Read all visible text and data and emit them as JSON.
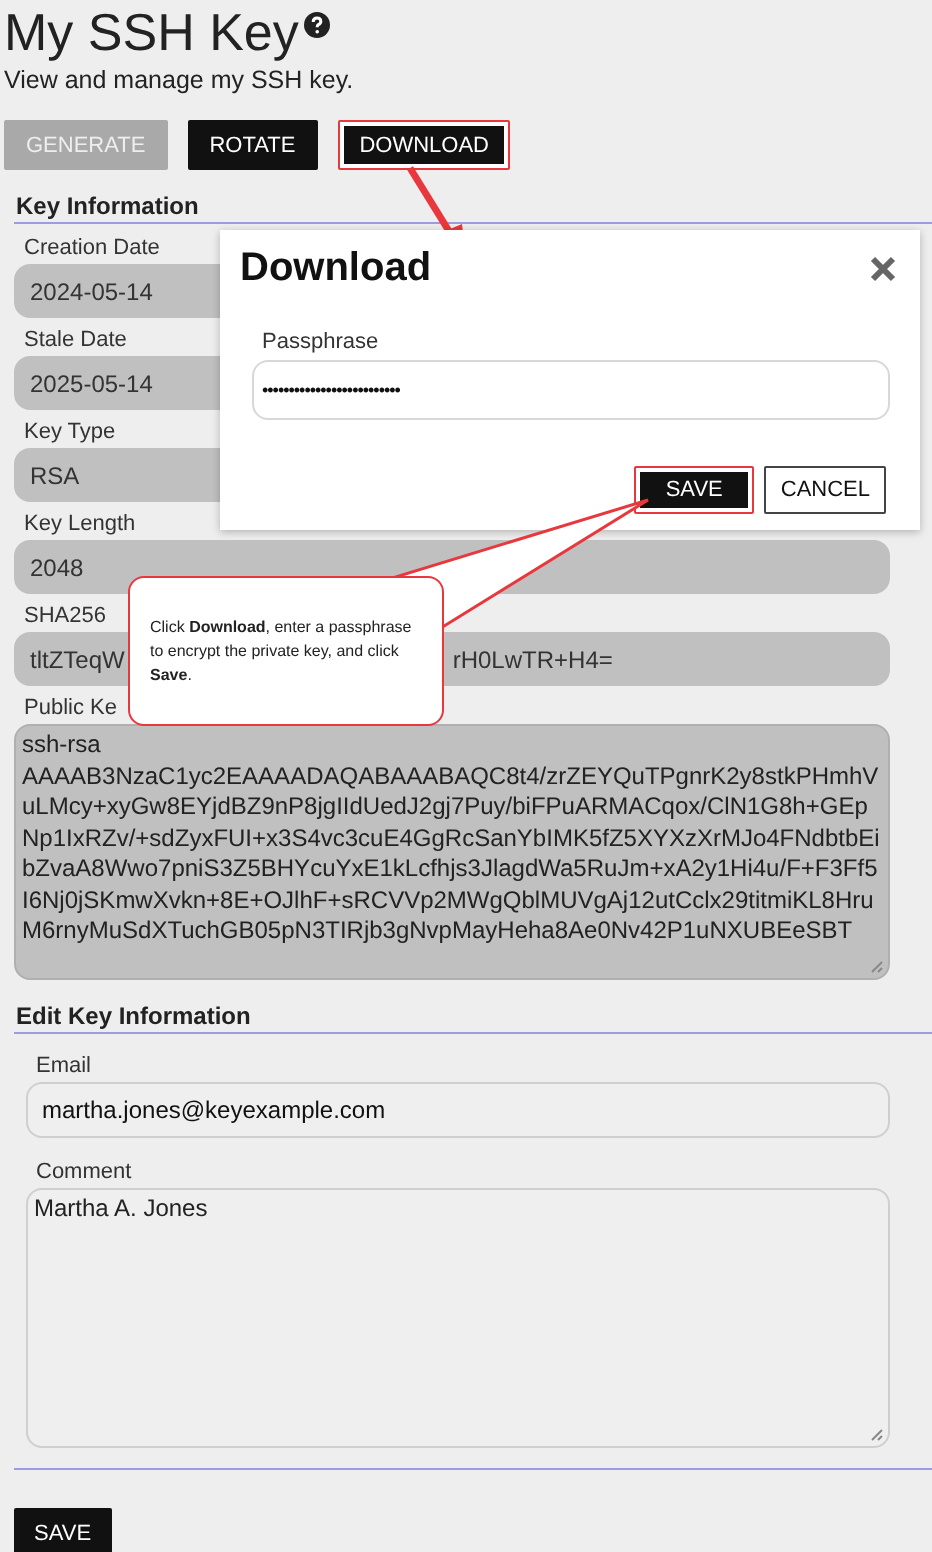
{
  "page": {
    "title": "My SSH Key",
    "subtitle": "View and manage my SSH key."
  },
  "actions": [
    {
      "label": "GENERATE",
      "disabled": true,
      "highlighted": false
    },
    {
      "label": "ROTATE",
      "disabled": false,
      "highlighted": false
    },
    {
      "label": "DOWNLOAD",
      "disabled": false,
      "highlighted": true
    }
  ],
  "key_information": {
    "heading": "Key Information",
    "fields": [
      {
        "label": "Creation Date",
        "value": "2024-05-14",
        "kind": "text"
      },
      {
        "label": "Stale Date",
        "value": "2025-05-14",
        "kind": "text"
      },
      {
        "label": "Key Type",
        "value": "RSA",
        "kind": "text"
      },
      {
        "label": "Key Length",
        "value": "2048",
        "kind": "text"
      },
      {
        "label": "SHA256",
        "value": "tltZTeqW",
        "value_tail": "rH0LwTR+H4=",
        "kind": "text"
      },
      {
        "label": "Public Ke",
        "value": "ssh-rsa AAAAB3NzaC1yc2EAAAADAQABAAABAQC8t4/zrZEYQuTPgnrK2y8stkPHmhVuLMcy+xyGw8EYjdBZ9nP8jgIIdUedJ2gj7Puy/biFPuARMACqox/ClN1G8h+GEpNp1IxRZv/+sdZyxFUI+x3S4vc3cuE4GgRcSanYbIMK5fZ5XYXzXrMJo4FNdbtbEibZvaA8Wwo7pniS3Z5BHYcuYxE1kLcfhjs3JlagdWa5RuJm+xA2y1Hi4u/F+F3Ff5I6Nj0jSKmwXvkn+8E+OJlhF+sRCVVp2MWgQblMUVgAj12utCclx29titmiKL8HruM6rnyMuSdXTuchGB05pN3TIRjb3gNvpMayHeha8Ae0Nv42P1uNXUBEeSBT",
        "kind": "textarea"
      }
    ]
  },
  "edit_key_information": {
    "heading": "Edit Key Information",
    "fields": [
      {
        "label": "Email",
        "value": "martha.jones@keyexample.com",
        "kind": "text"
      },
      {
        "label": "Comment",
        "value": "Martha A. Jones",
        "kind": "textarea"
      }
    ]
  },
  "save_button": {
    "label": "SAVE"
  },
  "dialog": {
    "title": "Download",
    "field": {
      "label": "Passphrase",
      "value": "••••••••••••••••••••••••••"
    },
    "buttons": [
      {
        "label": "SAVE",
        "kind": "primary",
        "highlighted": true
      },
      {
        "label": "CANCEL",
        "kind": "secondary",
        "highlighted": false
      }
    ]
  },
  "callout": {
    "text": "Click **Download**, enter a passphrase to encrypt the private key, and click **Save**."
  }
}
